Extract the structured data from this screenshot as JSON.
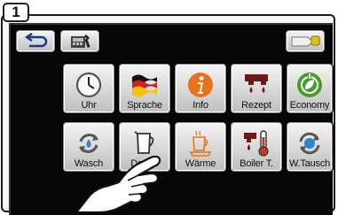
{
  "figure_number": "1",
  "toolbar": {
    "back_icon": "return-arrow-icon",
    "device_icon": "machine-settings-icon",
    "right_icon": "card-key-icon"
  },
  "menu": {
    "row1": [
      {
        "label": "Uhr",
        "icon": "clock-icon"
      },
      {
        "label": "Sprache",
        "icon": "german-flag-icon"
      },
      {
        "label": "Info",
        "icon": "info-icon"
      },
      {
        "label": "Rezept",
        "icon": "recipe-drops-icon"
      },
      {
        "label": "Economy",
        "icon": "power-leaf-icon"
      }
    ],
    "row2": [
      {
        "label": "Wasch",
        "icon": "rinse-cycle-icon"
      },
      {
        "label": "Dampf",
        "icon": "milk-jug-icon"
      },
      {
        "label": "Wärme",
        "icon": "cup-warmer-icon"
      },
      {
        "label": "Boiler T.",
        "icon": "boiler-thermometer-icon"
      },
      {
        "label": "W.Tausch",
        "icon": "filter-exchange-icon"
      }
    ]
  },
  "colors": {
    "screen": "#070707",
    "button": "#d9d9d9",
    "accent_orange": "#e8731c",
    "accent_green": "#4a9c2a",
    "accent_red": "#c0392b",
    "accent_blue": "#2a86c8"
  }
}
